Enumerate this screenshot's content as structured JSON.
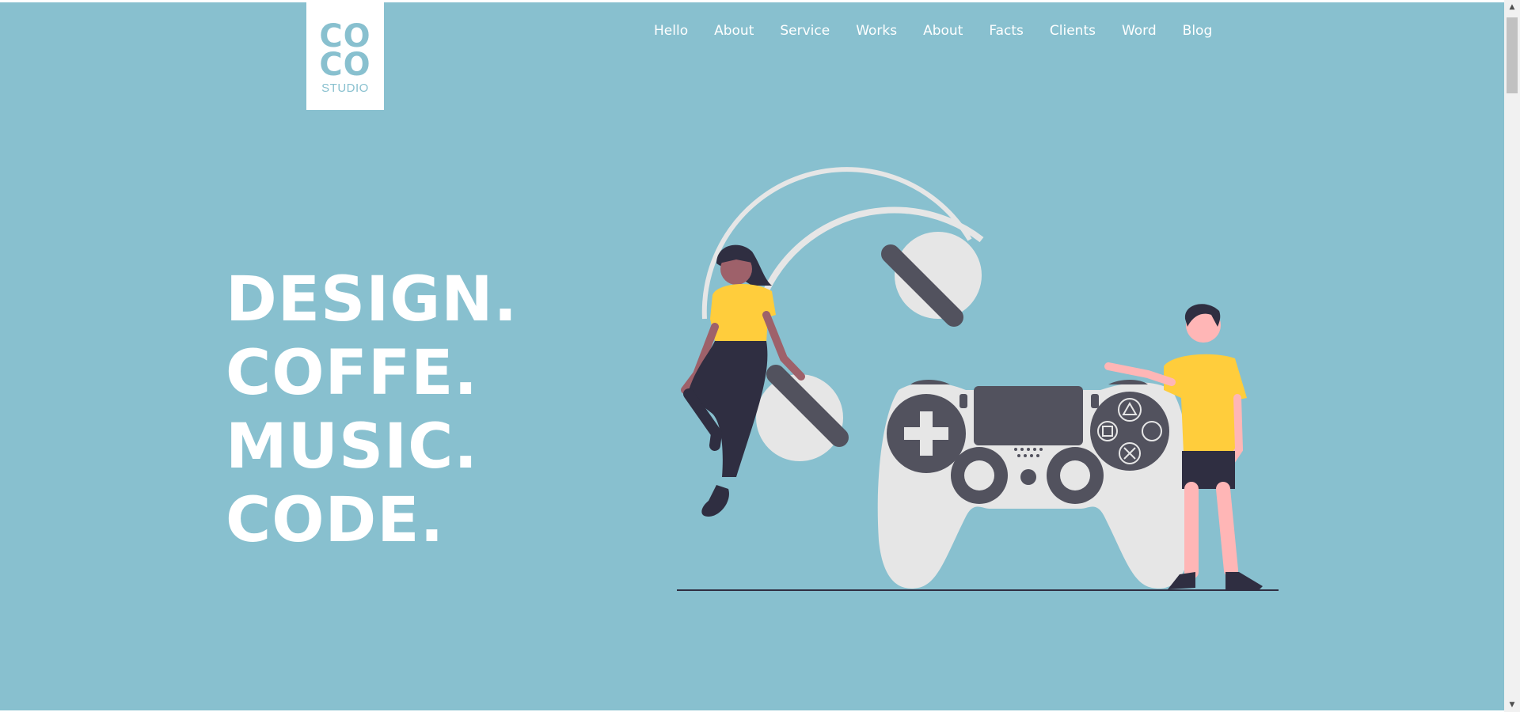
{
  "brand": {
    "logo_line1": "CO",
    "logo_line2": "CO",
    "logo_sub": "STUDIO"
  },
  "nav": {
    "items": [
      {
        "label": "Hello"
      },
      {
        "label": "About"
      },
      {
        "label": "Service"
      },
      {
        "label": "Works"
      },
      {
        "label": "About"
      },
      {
        "label": "Facts"
      },
      {
        "label": "Clients"
      },
      {
        "label": "Word"
      },
      {
        "label": "Blog"
      }
    ]
  },
  "hero": {
    "lines": [
      "DESIGN.",
      "COFFE.",
      "MUSIC.",
      "CODE."
    ]
  },
  "colors": {
    "background": "#88c0cf",
    "text": "#ffffff",
    "accent_yellow": "#ffcd3c",
    "dark": "#52525e",
    "light_gray": "#e6e6e6"
  },
  "icons": {
    "illustration": "people-gaming-headphones-illustration",
    "scroll_up": "chevron-up-icon",
    "scroll_down": "chevron-down-icon"
  }
}
